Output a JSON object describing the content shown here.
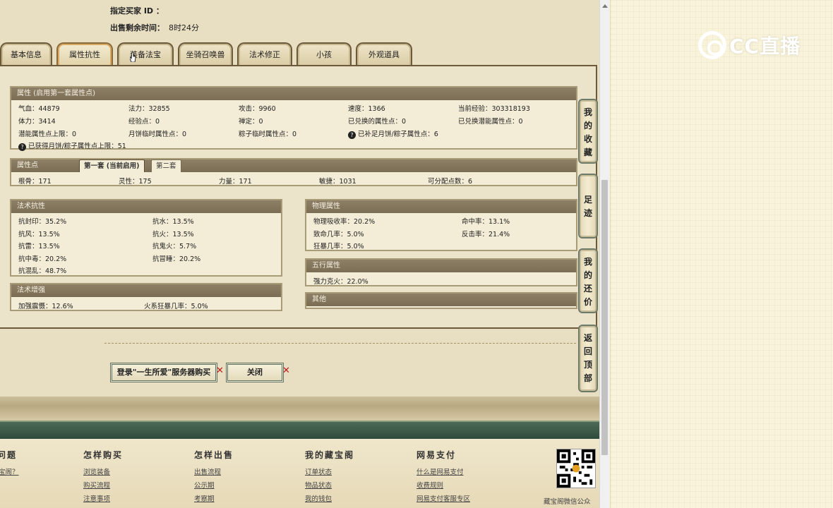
{
  "header": {
    "buyer_id_label": "指定买家 ID ：",
    "remaining_label": "出售剩余时间：",
    "remaining_value": "8时24分"
  },
  "tabs": [
    "基本信息",
    "属性抗性",
    "装备法宝",
    "坐骑召唤兽",
    "法术修正",
    "小孩",
    "外观道具"
  ],
  "active_tab_index": 1,
  "attr": {
    "title": "属性 (启用第一套属性点)",
    "rows": [
      [
        "气血：44879",
        "法力：32855",
        "攻击：9960",
        "速度：1366",
        "当前经验：303318193"
      ],
      [
        "体力：3414",
        "经验点：0",
        "禅定：0",
        "已兑换的属性点：0",
        "已兑换潜能属性点：0"
      ],
      [
        "潜能属性点上限：0",
        "月饼临时属性点：0",
        "粽子临时属性点：0",
        "已补足月饼/粽子属性点：6"
      ],
      [
        "已获得月饼/粽子属性点上限：51"
      ]
    ]
  },
  "points": {
    "title": "属性点",
    "tab1": "第一套 (当前启用)",
    "tab2": "第二套",
    "values": [
      "根骨：171",
      "灵性：175",
      "力量：171",
      "敏捷：1031",
      "可分配点数：6"
    ]
  },
  "resist": {
    "title": "法术抗性",
    "items": [
      "抗封印：35.2%",
      "抗水：13.5%",
      "抗风：13.5%",
      "抗火：13.5%",
      "抗雷：13.5%",
      "抗鬼火：5.7%",
      "抗中毒：20.2%",
      "抗冒睡：20.2%",
      "抗混乱：48.7%"
    ]
  },
  "boost": {
    "title": "法术增强",
    "items": [
      "加强震慑：12.6%",
      "火系狂暴几率：5.0%"
    ]
  },
  "phys": {
    "title": "物理属性",
    "items": [
      "物理吸收率：20.2%",
      "命中率：13.1%",
      "致命几率：5.0%",
      "反击率：21.4%",
      "狂暴几率：5.0%"
    ]
  },
  "five": {
    "title": "五行属性",
    "items": [
      "强力克火：22.0%"
    ]
  },
  "other": {
    "title": "其他"
  },
  "side_buttons": [
    "我的收藏",
    "足迹",
    "我的还价",
    "返回顶部"
  ],
  "buttons": {
    "buy": "登录\"一生所爱\"服务器购买",
    "close": "关闭"
  },
  "footer": {
    "cols": [
      {
        "title": "问题",
        "links": [
          "宝阁？"
        ]
      },
      {
        "title": "怎样购买",
        "links": [
          "浏览装备",
          "购买流程",
          "注意事项"
        ]
      },
      {
        "title": "怎样出售",
        "links": [
          "出售流程",
          "公示期",
          "考察期"
        ]
      },
      {
        "title": "我的藏宝阁",
        "links": [
          "订单状态",
          "物品状态",
          "我的钱包"
        ]
      },
      {
        "title": "网易支付",
        "links": [
          "什么是网易支付",
          "收费规则",
          "网易支付客服专区"
        ]
      }
    ],
    "qr_caption": "藏宝阁微信公众"
  },
  "watermark": "CC直播"
}
